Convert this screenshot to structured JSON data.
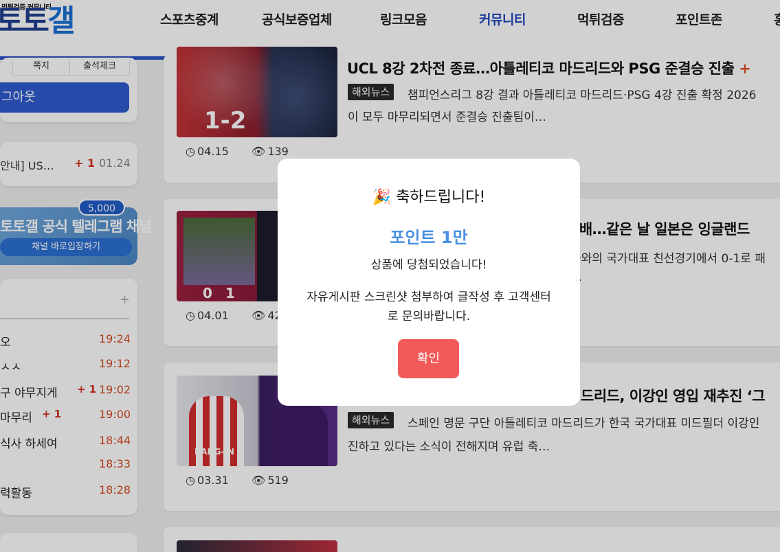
{
  "header": {
    "logo_small": "먹튀검증 커뮤니티",
    "logo_main_1": "토토",
    "logo_main_2": "갤",
    "nav": [
      "스포츠중계",
      "공식보증업체",
      "링크모음",
      "커뮤니티",
      "먹튀검증",
      "포인트존",
      "홍"
    ],
    "active_nav": "커뮤니티"
  },
  "sidebar": {
    "tabs": [
      "쪽지",
      "출석체크"
    ],
    "logout_label": "그아웃",
    "notice": {
      "text": "안내] US…",
      "plus": "+ 1",
      "date": "01.24"
    },
    "banner": {
      "badge": "5,000",
      "title": "토토갤 공식 텔레그램 채널",
      "button": "채널 바로입장하기"
    },
    "list_plus": "+",
    "list_items": [
      {
        "text": "오",
        "plus": "",
        "time": "19:24"
      },
      {
        "text": "ㅅㅅ",
        "plus": "",
        "time": "19:12"
      },
      {
        "text": "구 야무지게",
        "plus": "+ 1",
        "time": "19:02"
      },
      {
        "text": "마무리",
        "plus": "+ 1",
        "time": "19:00"
      },
      {
        "text": "식사 하세여",
        "plus": "",
        "time": "18:44"
      },
      {
        "text": "",
        "plus": "",
        "time": "18:33"
      },
      {
        "text": "력활동",
        "plus": "",
        "time": "18:28"
      }
    ]
  },
  "articles": [
    {
      "title": "UCL 8강 2차전 종료…아틀레티코 마드리드와 PSG 준결승 진출",
      "plus": "+",
      "category": "해외뉴스",
      "desc1": "챔피언스리그 8강 결과 아틀레티코 마드리드·PSG 4강 진출 확정 2026",
      "desc2": "이 모두 마무리되면서 준결승 진출팀이…",
      "date": "04.15",
      "views": "139",
      "score": "1-2"
    },
    {
      "title": "패배…같은 날 일본은 잉글랜드",
      "category": "",
      "desc1": "아와의 국가대표 친선경기에서 0-1로 패",
      "desc2": "…",
      "date": "04.01",
      "views": "42",
      "score": "0 1"
    },
    {
      "title": "드리드, 이강인 영입 재추진 ‘그",
      "category": "해외뉴스",
      "desc1": "스페인 명문 구단 아틀레티코 마드리드가 한국 국가대표 미드필더 이강인",
      "desc2": "진하고 있다는 소식이 전해지며 유럽 축…",
      "date": "03.31",
      "views": "519",
      "player_name": "KANG-IN"
    }
  ],
  "modal": {
    "emoji": "🎉",
    "title": "축하드립니다!",
    "prize": "포인트 1만",
    "line1": "상품에 당첨되었습니다!",
    "line2": "자유게시판 스크린샷 첨부하여 글작성 후 고객센터로 문의바랍니다.",
    "confirm": "확인"
  },
  "colors": {
    "accent": "#2d55c8",
    "modal_button": "#f25a5a",
    "prize": "#4a90e2"
  }
}
